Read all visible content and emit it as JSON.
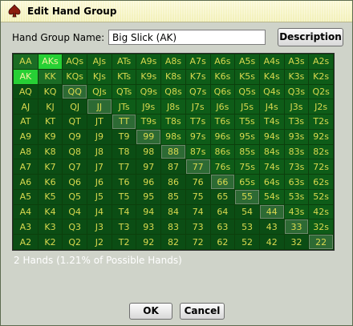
{
  "window": {
    "title": "Edit Hand Group"
  },
  "form": {
    "name_label": "Hand Group Name:",
    "name_value": "Big Slick (AK)",
    "description_label": "Description"
  },
  "status_text": "2 Hands  (1.21% of Possible Hands)",
  "buttons": {
    "ok": "OK",
    "cancel": "Cancel"
  },
  "icons": {
    "title_icon": "spade-icon"
  },
  "colors": {
    "grid_bg": "#0b4d14",
    "cell_text": "#d9d94f",
    "selected": "#27d035"
  },
  "hand_grid": {
    "rows": [
      [
        "AA",
        "AKs",
        "AQs",
        "AJs",
        "ATs",
        "A9s",
        "A8s",
        "A7s",
        "A6s",
        "A5s",
        "A4s",
        "A3s",
        "A2s"
      ],
      [
        "AK",
        "KK",
        "KQs",
        "KJs",
        "KTs",
        "K9s",
        "K8s",
        "K7s",
        "K6s",
        "K5s",
        "K4s",
        "K3s",
        "K2s"
      ],
      [
        "AQ",
        "KQ",
        "QQ",
        "QJs",
        "QTs",
        "Q9s",
        "Q8s",
        "Q7s",
        "Q6s",
        "Q5s",
        "Q4s",
        "Q3s",
        "Q2s"
      ],
      [
        "AJ",
        "KJ",
        "QJ",
        "JJ",
        "JTs",
        "J9s",
        "J8s",
        "J7s",
        "J6s",
        "J5s",
        "J4s",
        "J3s",
        "J2s"
      ],
      [
        "AT",
        "KT",
        "QT",
        "JT",
        "TT",
        "T9s",
        "T8s",
        "T7s",
        "T6s",
        "T5s",
        "T4s",
        "T3s",
        "T2s"
      ],
      [
        "A9",
        "K9",
        "Q9",
        "J9",
        "T9",
        "99",
        "98s",
        "97s",
        "96s",
        "95s",
        "94s",
        "93s",
        "92s"
      ],
      [
        "A8",
        "K8",
        "Q8",
        "J8",
        "T8",
        "98",
        "88",
        "87s",
        "86s",
        "85s",
        "84s",
        "83s",
        "82s"
      ],
      [
        "A7",
        "K7",
        "Q7",
        "J7",
        "T7",
        "97",
        "87",
        "77",
        "76s",
        "75s",
        "74s",
        "73s",
        "72s"
      ],
      [
        "A6",
        "K6",
        "Q6",
        "J6",
        "T6",
        "96",
        "86",
        "76",
        "66",
        "65s",
        "64s",
        "63s",
        "62s"
      ],
      [
        "A5",
        "K5",
        "Q5",
        "J5",
        "T5",
        "95",
        "85",
        "75",
        "65",
        "55",
        "54s",
        "53s",
        "52s"
      ],
      [
        "A4",
        "K4",
        "Q4",
        "J4",
        "T4",
        "94",
        "84",
        "74",
        "64",
        "54",
        "44",
        "43s",
        "42s"
      ],
      [
        "A3",
        "K3",
        "Q3",
        "J3",
        "T3",
        "93",
        "83",
        "73",
        "63",
        "53",
        "43",
        "33",
        "32s"
      ],
      [
        "A2",
        "K2",
        "Q2",
        "J2",
        "T2",
        "92",
        "82",
        "72",
        "62",
        "52",
        "42",
        "32",
        "22"
      ]
    ],
    "selected": [
      "AKs",
      "AK"
    ]
  }
}
